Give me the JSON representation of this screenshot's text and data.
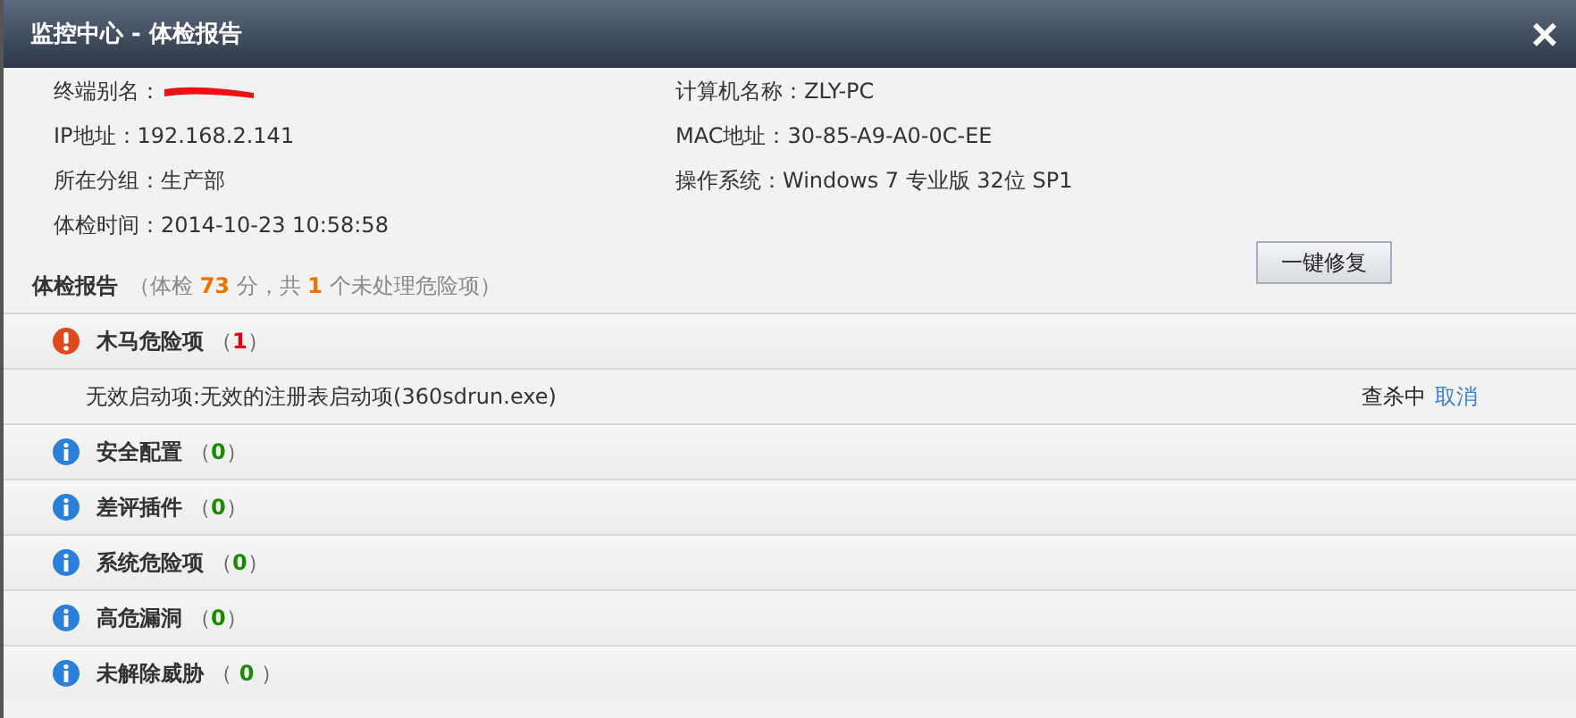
{
  "window": {
    "title": "监控中心 - 体检报告",
    "close": "×"
  },
  "info": [
    {
      "label": "终端别名：",
      "redacted": true
    },
    {
      "label": "计算机名称：",
      "value": "ZLY-PC",
      "redacted": false
    },
    {
      "label": "IP地址：",
      "value": "192.168.2.141",
      "redacted": false
    },
    {
      "label": "MAC地址：",
      "value": "30-85-A9-A0-0C-EE",
      "redacted": false
    },
    {
      "label": "所在分组：",
      "value": "生产部",
      "redacted": false
    },
    {
      "label": "操作系统：",
      "value": "Windows 7 专业版 32位 SP1",
      "redacted": false
    },
    {
      "label": "体检时间：",
      "value": "2014-10-23 10:58:58",
      "redacted": false
    }
  ],
  "report": {
    "title": "体检报告",
    "summary": "（体检 **73** 分，共 **1** 个未处理危险项）",
    "fix_button": "一键修复"
  },
  "categories": [
    {
      "kind": "danger",
      "name": "木马危险项",
      "count": "（**1**）",
      "children": [
        {
          "text": "无效启动项:无效的注册表启动项(360sdrun.exe)",
          "status": "查杀中",
          "action": "取消"
        }
      ]
    },
    {
      "kind": "info",
      "name": "安全配置",
      "count": "（**0**）"
    },
    {
      "kind": "info",
      "name": "差评插件",
      "count": "（**0**）"
    },
    {
      "kind": "info",
      "name": "系统危险项",
      "count": "（**0**）"
    },
    {
      "kind": "info",
      "name": "高危漏洞",
      "count": "（**0**）"
    },
    {
      "kind": "info",
      "name": "未解除威胁",
      "count": "（ **0** ）"
    }
  ]
}
